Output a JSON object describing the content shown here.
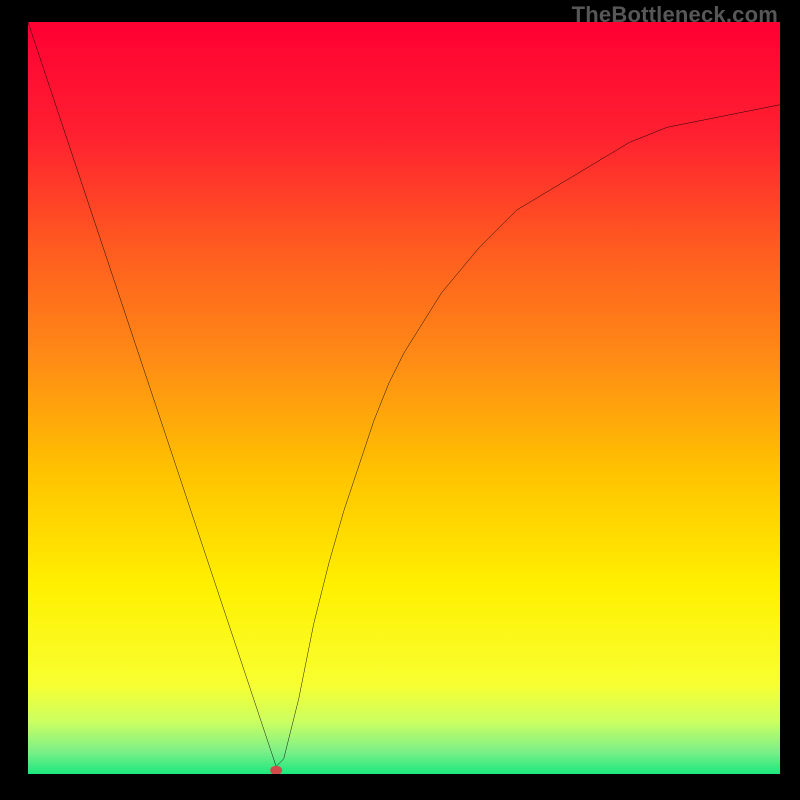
{
  "watermark": "TheBottleneck.com",
  "chart_data": {
    "type": "line",
    "title": "",
    "xlabel": "",
    "ylabel": "",
    "xlim": [
      0,
      100
    ],
    "ylim": [
      0,
      100
    ],
    "legend": false,
    "grid": false,
    "background": {
      "type": "vertical-gradient",
      "stops": [
        {
          "pos": 0.0,
          "color": "#ff0033"
        },
        {
          "pos": 0.15,
          "color": "#ff2030"
        },
        {
          "pos": 0.3,
          "color": "#ff5b20"
        },
        {
          "pos": 0.45,
          "color": "#ff8c15"
        },
        {
          "pos": 0.6,
          "color": "#ffc300"
        },
        {
          "pos": 0.75,
          "color": "#fff000"
        },
        {
          "pos": 0.88,
          "color": "#f8ff30"
        },
        {
          "pos": 0.93,
          "color": "#ccff60"
        },
        {
          "pos": 0.97,
          "color": "#7cf088"
        },
        {
          "pos": 1.0,
          "color": "#1de87e"
        }
      ]
    },
    "series": [
      {
        "name": "bottleneck-curve",
        "color": "#000000",
        "x": [
          0,
          2,
          4,
          6,
          8,
          10,
          12,
          14,
          16,
          18,
          20,
          22,
          24,
          26,
          28,
          30,
          32,
          33,
          34,
          36,
          38,
          40,
          42,
          44,
          46,
          48,
          50,
          55,
          60,
          65,
          70,
          75,
          80,
          85,
          90,
          95,
          100
        ],
        "y": [
          100,
          94,
          88,
          82,
          76,
          70,
          64,
          58,
          52,
          46,
          40,
          34,
          28,
          22,
          16,
          10,
          4,
          1,
          2,
          10,
          20,
          28,
          35,
          41,
          47,
          52,
          56,
          64,
          70,
          75,
          78,
          81,
          84,
          86,
          87,
          88,
          89
        ]
      }
    ],
    "markers": [
      {
        "name": "minimum-marker",
        "x": 33,
        "y": 0.5,
        "color": "#d24a4a",
        "shape": "rounded-rect"
      }
    ],
    "description": "V-shaped bottleneck curve over a vertical red-to-green spectral gradient. Left branch descends roughly linearly from the top-left corner to a sharp minimum near x≈33 at the baseline; right branch rises with diminishing slope, asymptoting near y≈89 at the right edge. A small red rounded marker sits at the curve minimum on the green baseline."
  }
}
